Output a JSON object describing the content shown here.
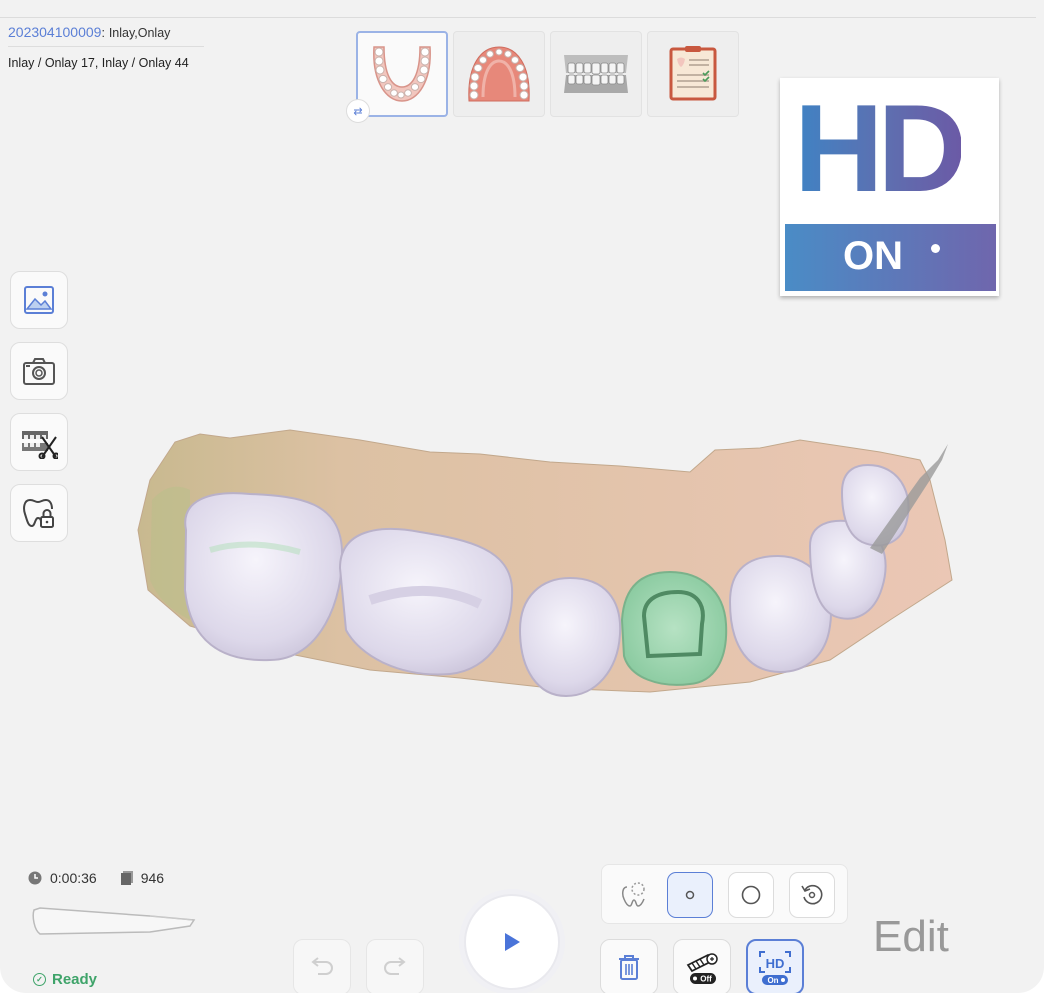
{
  "case": {
    "id": "202304100009",
    "separator": ":",
    "type": "Inlay,Onlay",
    "teeth": "Inlay / Onlay 17, Inlay / Onlay 44"
  },
  "thumbnails": [
    {
      "name": "lower-jaw",
      "active": true
    },
    {
      "name": "upper-jaw",
      "active": false
    },
    {
      "name": "occlusion",
      "active": false
    },
    {
      "name": "prescription",
      "active": false
    }
  ],
  "hd_badge": {
    "big": "HD",
    "small": "ON"
  },
  "side_tools": [
    "image-icon",
    "camera-icon",
    "trim-icon",
    "lock-tooth-icon"
  ],
  "status": {
    "scan_time": "0:00:36",
    "frame_count": "946",
    "state": "Ready"
  },
  "bottom_toggles": {
    "ai_filter": "Off",
    "hd": "On",
    "hd_label": "HD"
  },
  "edit_label": "Edit",
  "colors": {
    "accent": "#5b7fd6",
    "ready": "#3fa46a",
    "hd_gradient_start": "#3f83c4",
    "hd_gradient_end": "#6b5aa6"
  }
}
